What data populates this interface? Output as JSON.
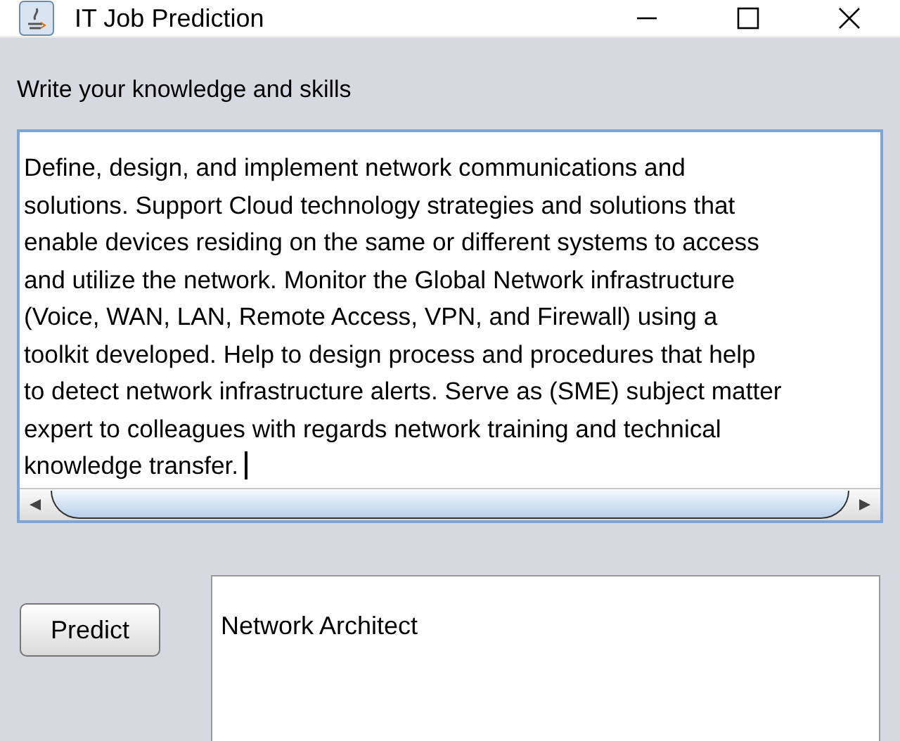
{
  "window": {
    "title": "IT Job Prediction"
  },
  "prompt_label": "Write your knowledge and skills",
  "skills_text": "Define, design, and implement network communications and\nsolutions. Support Cloud technology strategies and solutions that\nenable devices residing on the same or different systems to access\nand utilize the network. Monitor the Global Network infrastructure\n(Voice, WAN, LAN, Remote Access, VPN, and Firewall) using a\ntoolkit developed. Help to design process and procedures that help\nto detect network infrastructure alerts. Serve as (SME) subject matter\nexpert to colleagues with regards network training and technical\nknowledge transfer. ",
  "predict_button": "Predict",
  "prediction": "Network Architect"
}
